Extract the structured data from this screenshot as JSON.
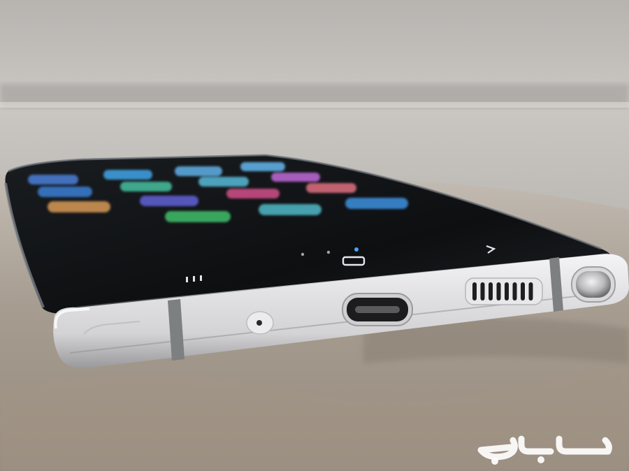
{
  "photo": {
    "subject": "smartphone-bottom-edge",
    "colors": {
      "wall": "#c8c5c1",
      "wall_seam": "#8f8c88",
      "surface": "#a3998d",
      "chrome": "#e6e6e8",
      "screen": "#111315"
    }
  },
  "screen": {
    "app_icon_colors": [
      "#4a7fd8",
      "#3fa4e6",
      "#5fb0e8",
      "#62b6ee",
      "#3a7ed4",
      "#46c0a0",
      "#56b9d8",
      "#d24f8a",
      "#c06ad8",
      "#e07080",
      "#d89a55",
      "#5f62d8",
      "#3fbf6a",
      "#4fb8c8",
      "#3d90e0"
    ]
  },
  "watermark": {
    "text": "حراج"
  }
}
